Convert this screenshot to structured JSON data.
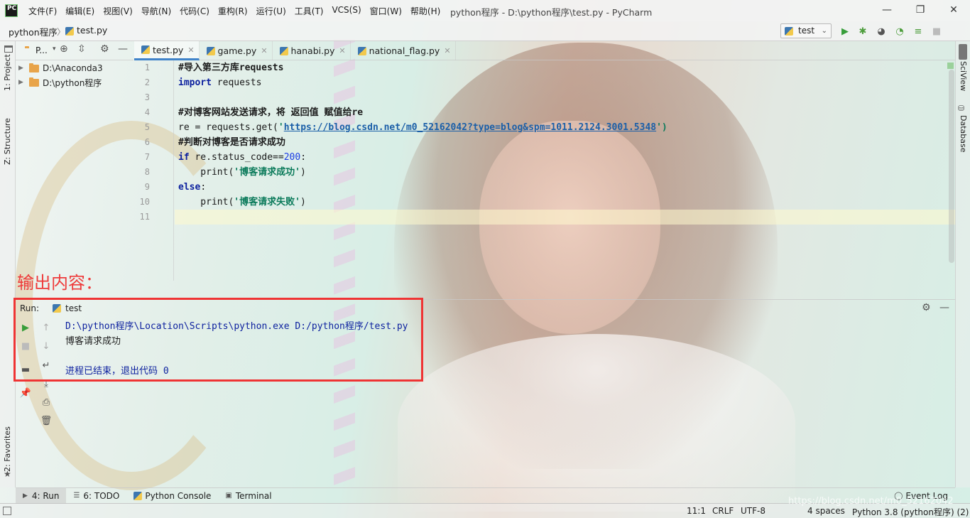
{
  "app": {
    "window_title": "python程序 - D:\\python程序\\test.py - PyCharm",
    "logo": "PC"
  },
  "menu": [
    "文件(F)",
    "编辑(E)",
    "视图(V)",
    "导航(N)",
    "代码(C)",
    "重构(R)",
    "运行(U)",
    "工具(T)",
    "VCS(S)",
    "窗口(W)",
    "帮助(H)"
  ],
  "window_controls": {
    "minimize": "—",
    "maximize": "❐",
    "close": "✕"
  },
  "breadcrumb": {
    "project": "python程序",
    "file": "test.py"
  },
  "run_config": {
    "name": "test"
  },
  "left_tools": {
    "project": "1: Project",
    "structure": "Z: Structure",
    "favorites": "2: Favorites"
  },
  "right_tools": {
    "sciview": "SciView",
    "database": "Database"
  },
  "project_panel": {
    "title": "P...",
    "items": [
      {
        "label": "D:\\Anaconda3"
      },
      {
        "label": "D:\\python程序"
      }
    ]
  },
  "tabs": [
    {
      "label": "test.py",
      "active": true
    },
    {
      "label": "game.py"
    },
    {
      "label": "hanabi.py"
    },
    {
      "label": "national_flag.py"
    }
  ],
  "editor": {
    "lines": [
      {
        "n": "1"
      },
      {
        "n": "2"
      },
      {
        "n": "3"
      },
      {
        "n": "4"
      },
      {
        "n": "5"
      },
      {
        "n": "6"
      },
      {
        "n": "7"
      },
      {
        "n": "8"
      },
      {
        "n": "9"
      },
      {
        "n": "10"
      },
      {
        "n": "11"
      }
    ],
    "code": {
      "l1": "#导入第三方库requests",
      "l2_kw": "import",
      "l2_rest": " requests",
      "l4": "#对博客网站发送请求，将 返回值 赋值给re",
      "l5_a": "re = requests.get(",
      "l5_q": "'",
      "l5_url": "https://blog.csdn.net/m0_52162042?type=blog&spm=1011.2124.3001.5348",
      "l5_end": "')",
      "l6": "#判断对博客是否请求成功",
      "l7_kw": "if",
      "l7_a": " re.status_code==",
      "l7_num": "200",
      "l7_b": ":",
      "l8_fn": "    print(",
      "l8_str": "'博客请求成功'",
      "l8_end": ")",
      "l9_kw": "else",
      "l9_b": ":",
      "l10_fn": "    print(",
      "l10_str": "'博客请求失败'",
      "l10_end": ")"
    }
  },
  "annotation": "输出内容：",
  "run_panel": {
    "label": "Run:",
    "tab": "test",
    "output": [
      "D:\\python程序\\Location\\Scripts\\python.exe D:/python程序/test.py",
      "博客请求成功",
      "",
      "进程已结束，退出代码 0"
    ]
  },
  "bottom_tools": [
    {
      "label": "4: Run",
      "active": true
    },
    {
      "label": "6: TODO"
    },
    {
      "label": "Python Console"
    },
    {
      "label": "Terminal"
    }
  ],
  "event_log": "Event Log",
  "status": {
    "position": "11:1",
    "line_sep": "CRLF",
    "encoding": "UTF-8",
    "indent": "4 spaces",
    "interpreter": "Python 3.8 (python程序) (2)"
  },
  "watermark": "https://blog.csdn.net/m0_52162042"
}
